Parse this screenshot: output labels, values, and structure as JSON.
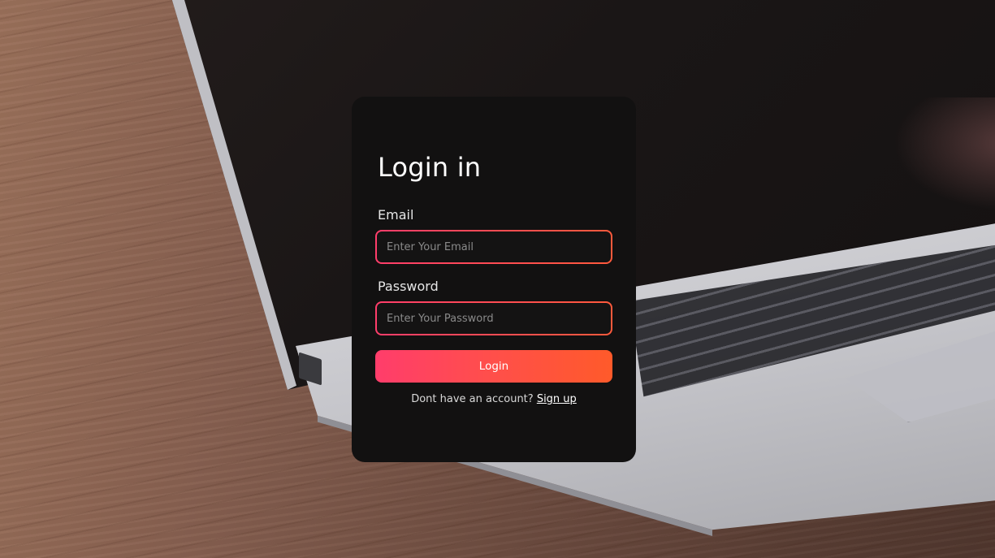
{
  "login_card": {
    "title": "Login in",
    "email": {
      "label": "Email",
      "value": "",
      "placeholder": "Enter Your Email"
    },
    "password": {
      "label": "Password",
      "value": "",
      "placeholder": "Enter Your Password"
    },
    "login_button_label": "Login",
    "signup_prompt": "Dont have an account?",
    "signup_link_label": "Sign up"
  },
  "colors": {
    "card_background": "#121111",
    "accent_start": "#ff3d6b",
    "accent_end": "#ff5a2a",
    "text_primary": "#ffffff"
  }
}
